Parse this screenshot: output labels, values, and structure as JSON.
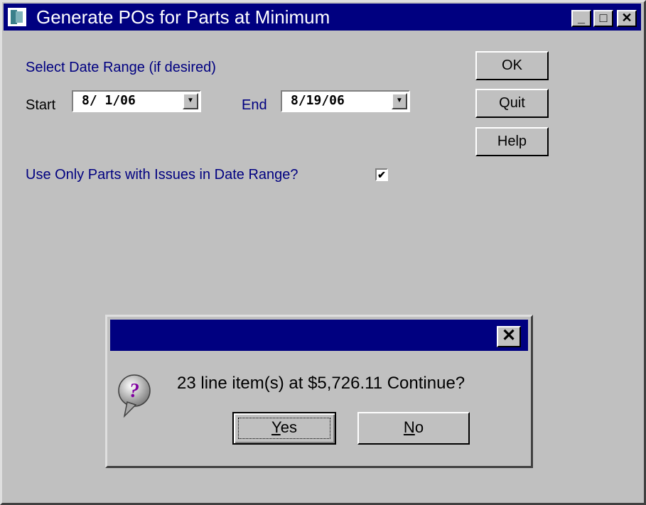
{
  "window": {
    "title": "Generate POs for Parts at Minimum",
    "minimize_glyph": "_",
    "maximize_glyph": "□",
    "close_glyph": "✕"
  },
  "form": {
    "date_range_heading": "Select Date Range (if desired)",
    "start_label": "Start",
    "start_value": "8/ 1/06",
    "end_label": "End",
    "end_value": "8/19/06",
    "dropdown_glyph": "▼",
    "issues_question": "Use Only Parts with Issues in Date Range?",
    "issues_checked_glyph": "✔"
  },
  "buttons": {
    "ok": "OK",
    "quit": "Quit",
    "help": "Help"
  },
  "dialog": {
    "close_glyph": "✕",
    "icon": "question-balloon-icon",
    "icon_glyph": "?",
    "message": "23 line item(s) at $5,726.11  Continue?",
    "yes_mnemonic": "Y",
    "yes_rest": "es",
    "no_mnemonic": "N",
    "no_rest": "o"
  }
}
